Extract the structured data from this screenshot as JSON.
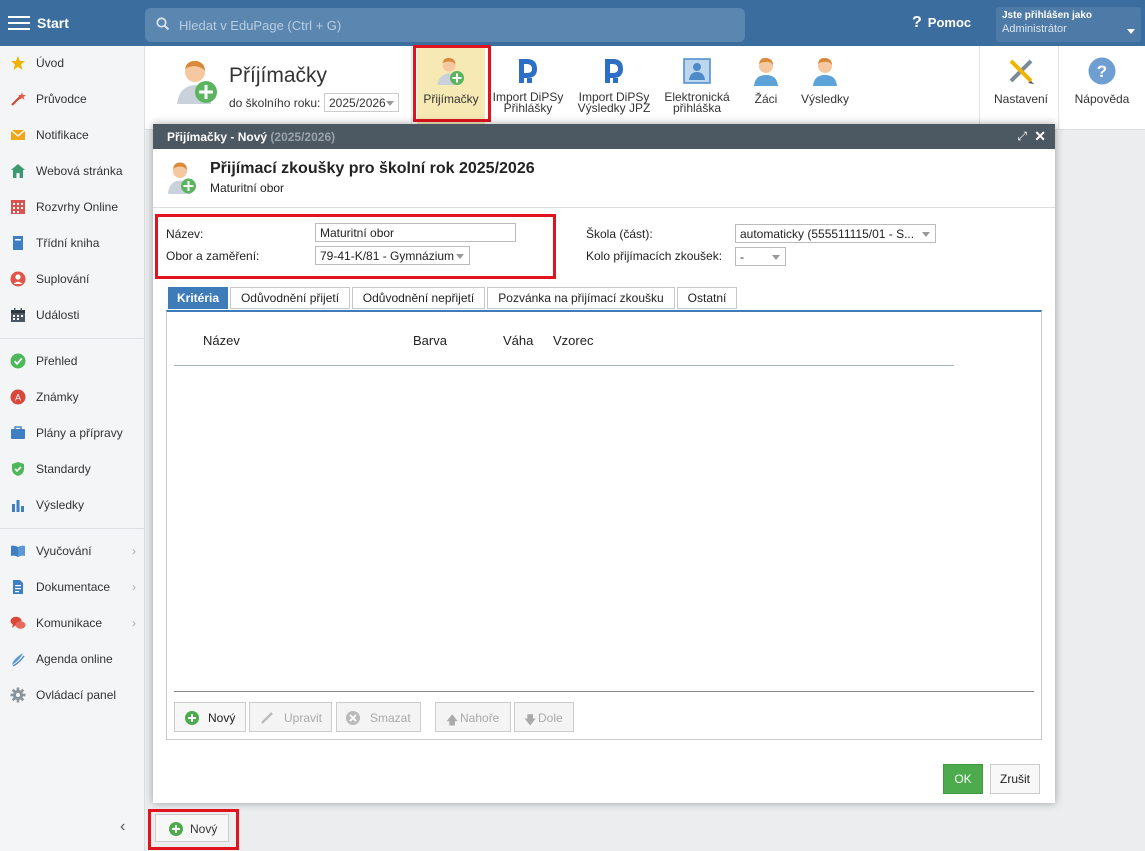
{
  "topbar": {
    "start_label": "Start",
    "search_placeholder": "Hledat v EduPage (Ctrl + G)",
    "help_label": "Pomoc",
    "user_line1": "Jste přihlášen jako",
    "user_line2": "Administrátor"
  },
  "sidebar": {
    "items": [
      {
        "label": "Úvod",
        "icon": "star-icon"
      },
      {
        "label": "Průvodce",
        "icon": "wand-icon"
      },
      {
        "label": "Notifikace",
        "icon": "envelope-icon"
      },
      {
        "label": "Webová stránka",
        "icon": "house-icon"
      },
      {
        "label": "Rozvrhy Online",
        "icon": "calendar-grid-icon"
      },
      {
        "label": "Třídní kniha",
        "icon": "book-icon"
      },
      {
        "label": "Suplování",
        "icon": "person-swap-icon"
      },
      {
        "label": "Události",
        "icon": "calendar-icon"
      },
      {
        "label": "Přehled",
        "icon": "check-circle-icon"
      },
      {
        "label": "Známky",
        "icon": "grade-icon"
      },
      {
        "label": "Plány a přípravy",
        "icon": "briefcase-icon"
      },
      {
        "label": "Standardy",
        "icon": "shield-check-icon"
      },
      {
        "label": "Výsledky",
        "icon": "bar-chart-icon"
      },
      {
        "label": "Vyučování",
        "icon": "open-book-icon"
      },
      {
        "label": "Dokumentace",
        "icon": "document-icon"
      },
      {
        "label": "Komunikace",
        "icon": "chat-icon"
      },
      {
        "label": "Agenda online",
        "icon": "pen-icon"
      },
      {
        "label": "Ovládací panel",
        "icon": "gear-icon"
      }
    ],
    "chevron": "›",
    "collapse_glyph": "‹"
  },
  "module": {
    "title": "Příjímačky",
    "year_label": "do školního roku:",
    "year_value": "2025/2026",
    "toolbar": [
      {
        "line1": "Přijímačky",
        "line2": ""
      },
      {
        "line1": "Import DiPSy",
        "line2": "Přihlášky"
      },
      {
        "line1": "Import DiPSy",
        "line2": "Výsledky JPZ"
      },
      {
        "line1": "Elektronická",
        "line2": "přihláška"
      },
      {
        "line1": "Žáci",
        "line2": ""
      },
      {
        "line1": "Výsledky",
        "line2": ""
      },
      {
        "line1": "Nastavení",
        "line2": ""
      },
      {
        "line1": "Nápověda",
        "line2": ""
      }
    ]
  },
  "dialog": {
    "title": "Přijímačky - Nový",
    "title_year": "(2025/2026)",
    "heading": "Přijímací zkoušky pro školní rok 2025/2026",
    "subheading": "Maturitní obor",
    "fields": {
      "name_label": "Název:",
      "name_value": "Maturitní obor",
      "obor_label": "Obor a zaměření:",
      "obor_value": "79-41-K/81 - Gymnázium",
      "school_label": "Škola (část):",
      "school_value": "automaticky (555511115/01 - S...",
      "round_label": "Kolo přijímacích zkoušek:",
      "round_value": "-"
    },
    "tabs": [
      "Kritéria",
      "Odůvodnění přijetí",
      "Odůvodnění nepřijetí",
      "Pozvánka na přijímací zkoušku",
      "Ostatní"
    ],
    "columns": [
      "Název",
      "Barva",
      "Váha",
      "Vzorec"
    ],
    "panel_buttons": {
      "new": "Nový",
      "edit": "Upravit",
      "delete": "Smazat",
      "up": "Nahoře",
      "down": "Dole"
    },
    "ok": "OK",
    "cancel": "Zrušit"
  },
  "bottom": {
    "new_label": "Nový"
  },
  "colors": {
    "topbar": "#3b6e9e",
    "dialog_titlebar": "#4c5862",
    "active_tab": "#3d7bb9",
    "ok_button": "#4cab4c",
    "highlight_box": "#e0131f"
  }
}
